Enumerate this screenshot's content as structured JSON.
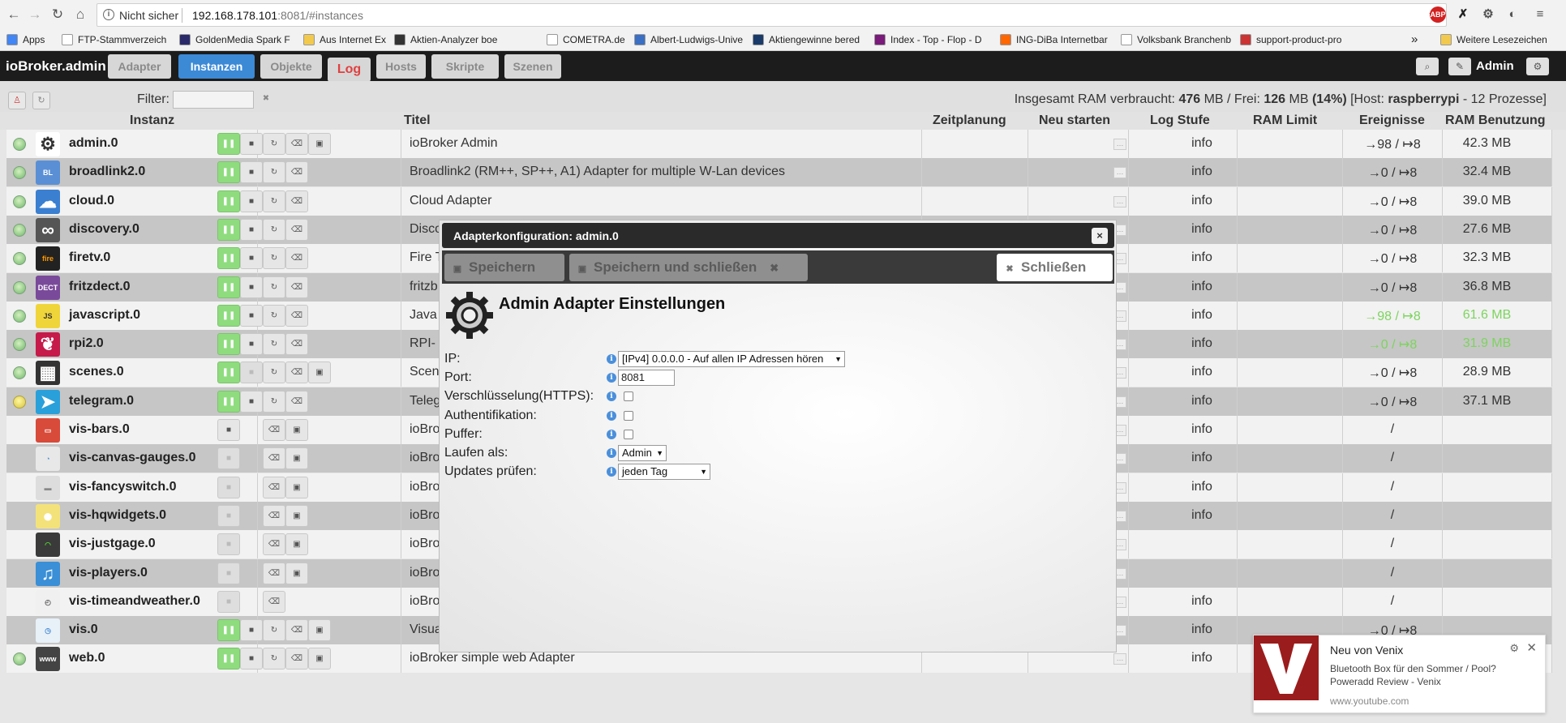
{
  "browser": {
    "security_label": "Nicht sicher",
    "url_host": "192.168.178.101",
    "url_rest": ":8081/#instances",
    "bookmarks": [
      {
        "label": "Apps",
        "color": "#4285f4"
      },
      {
        "label": "FTP-Stammverzeichn",
        "color": "#ffffff"
      },
      {
        "label": "GoldenMedia Spark F",
        "color": "#2a2a6a"
      },
      {
        "label": "Aus Internet Explorer",
        "color": "#f2c94c"
      },
      {
        "label": "Aktien-Analyzer boe",
        "color": "#333333"
      },
      {
        "label": "COMETRA.de",
        "color": "#ffffff"
      },
      {
        "label": "Albert-Ludwigs-Unive",
        "color": "#3a6fc4"
      },
      {
        "label": "Aktiengewinne bered",
        "color": "#1a3a6a"
      },
      {
        "label": "Index - Top - Flop - D",
        "color": "#7a1a7a"
      },
      {
        "label": "ING-DiBa Internetbar",
        "color": "#ff6600"
      },
      {
        "label": "Volksbank Branchenb",
        "color": "#ffffff"
      },
      {
        "label": "support-product-pro",
        "color": "#cc3333"
      },
      {
        "label": "Weitere Lesezeichen",
        "color": "#f2c94c"
      }
    ],
    "more_bookmarks": "»"
  },
  "topbar": {
    "brand": "ioBroker.admin",
    "tabs": [
      {
        "label": "Adapter",
        "active": false
      },
      {
        "label": "Instanzen",
        "active": true
      },
      {
        "label": "Objekte",
        "active": false
      },
      {
        "label": "Log",
        "active": false
      },
      {
        "label": "Hosts",
        "active": false
      },
      {
        "label": "Skripte",
        "active": false
      },
      {
        "label": "Szenen",
        "active": false
      }
    ],
    "user": "Admin"
  },
  "filter": {
    "label": "Filter:",
    "value": "",
    "ram_prefix": "Insgesamt RAM verbraucht: ",
    "ram_used": "476",
    "ram_mid": " MB / Frei: ",
    "ram_free": "126",
    "ram_mb": " MB ",
    "ram_pct": "(14%)",
    "ram_host_prefix": " [Host: ",
    "ram_host": "raspberrypi",
    "ram_suffix": " - 12 Prozesse]"
  },
  "columns": {
    "instance": "Instanz",
    "title": "Titel",
    "schedule": "Zeitplanung",
    "restart": "Neu starten",
    "loglevel": "Log Stufe",
    "ramlimit": "RAM Limit",
    "events": "Ereignisse",
    "ramusage": "RAM Benutzung"
  },
  "instances": [
    {
      "name": "admin.0",
      "title": "ioBroker Admin",
      "led": "green",
      "icon": "gear",
      "iconColor": "#ffffff",
      "controls": "full",
      "log": "info",
      "events": "→98 / ↦8",
      "ram": "42.3 MB",
      "highlight": false
    },
    {
      "name": "broadlink2.0",
      "title": "Broadlink2 (RM++, SP++, A1) Adapter for multiple W-Lan devices",
      "led": "green",
      "icon": "broadlink",
      "iconColor": "#5a8fd6",
      "controls": "noconfig",
      "log": "info",
      "events": "→0 / ↦8",
      "ram": "32.4 MB",
      "highlight": false
    },
    {
      "name": "cloud.0",
      "title": "Cloud Adapter",
      "led": "green",
      "icon": "cloud",
      "iconColor": "#3a7fd0",
      "controls": "noconfig",
      "log": "info",
      "events": "→0 / ↦8",
      "ram": "39.0 MB",
      "highlight": false
    },
    {
      "name": "discovery.0",
      "title": "Disco",
      "led": "green",
      "icon": "binoculars",
      "iconColor": "#555555",
      "controls": "noconfig",
      "log": "info",
      "events": "→0 / ↦8",
      "ram": "27.6 MB",
      "highlight": false
    },
    {
      "name": "firetv.0",
      "title": "Fire T",
      "led": "green",
      "icon": "firetv",
      "iconColor": "#222222",
      "controls": "noconfig",
      "log": "info",
      "events": "→0 / ↦8",
      "ram": "32.3 MB",
      "highlight": false
    },
    {
      "name": "fritzdect.0",
      "title": "fritzb",
      "led": "green",
      "icon": "fritz",
      "iconColor": "#7a4a9a",
      "controls": "noconfig",
      "log": "info",
      "events": "→0 / ↦8",
      "ram": "36.8 MB",
      "highlight": false
    },
    {
      "name": "javascript.0",
      "title": "Java",
      "led": "green",
      "icon": "js",
      "iconColor": "#f0d53a",
      "controls": "noconfig",
      "log": "info",
      "events": "→98 / ↦8",
      "ram": "61.6 MB",
      "highlight": true
    },
    {
      "name": "rpi2.0",
      "title": "RPI-",
      "led": "green",
      "icon": "raspberry",
      "iconColor": "#c51a4a",
      "controls": "noconfig",
      "log": "info",
      "events": "→0 / ↦8",
      "ram": "31.9 MB",
      "highlight": true
    },
    {
      "name": "scenes.0",
      "title": "Scen",
      "led": "green",
      "icon": "clapper",
      "iconColor": "#333333",
      "controls": "full-dimstop",
      "log": "info",
      "events": "→0 / ↦8",
      "ram": "28.9 MB",
      "highlight": false
    },
    {
      "name": "telegram.0",
      "title": "Teleg",
      "led": "yellow",
      "icon": "telegram",
      "iconColor": "#2aa0da",
      "controls": "noconfig",
      "log": "info",
      "events": "→0 / ↦8",
      "ram": "37.1 MB",
      "highlight": false
    },
    {
      "name": "vis-bars.0",
      "title": "ioBro",
      "led": "none",
      "icon": "visbars",
      "iconColor": "#d84a3a",
      "controls": "vis",
      "log": "info",
      "events": "/",
      "ram": "",
      "highlight": false
    },
    {
      "name": "vis-canvas-gauges.0",
      "title": "ioBro",
      "led": "none",
      "icon": "gauge",
      "iconColor": "#e8e8e8",
      "controls": "visdim",
      "log": "info",
      "events": "/",
      "ram": "",
      "highlight": false
    },
    {
      "name": "vis-fancyswitch.0",
      "title": "ioBro",
      "led": "none",
      "icon": "switch",
      "iconColor": "#dddddd",
      "controls": "visdim",
      "log": "info",
      "events": "/",
      "ram": "",
      "highlight": false
    },
    {
      "name": "vis-hqwidgets.0",
      "title": "ioBro",
      "led": "none",
      "icon": "bulb",
      "iconColor": "#f3e27a",
      "controls": "visdim",
      "log": "info",
      "events": "/",
      "ram": "",
      "highlight": false
    },
    {
      "name": "vis-justgage.0",
      "title": "ioBro",
      "led": "none",
      "icon": "justgage",
      "iconColor": "#3a3a3a",
      "controls": "visdim",
      "log": "",
      "events": "/",
      "ram": "",
      "highlight": false
    },
    {
      "name": "vis-players.0",
      "title": "ioBro",
      "led": "none",
      "icon": "music",
      "iconColor": "#3a8fd6",
      "controls": "visdim",
      "log": "",
      "events": "/",
      "ram": "",
      "highlight": false
    },
    {
      "name": "vis-timeandweather.0",
      "title": "ioBro",
      "led": "none",
      "icon": "clock",
      "iconColor": "#f0f0f0",
      "controls": "visdimnoimg",
      "log": "info",
      "events": "/",
      "ram": "",
      "highlight": false
    },
    {
      "name": "vis.0",
      "title": "Visua",
      "led": "none",
      "icon": "visgauge",
      "iconColor": "#e8f0f8",
      "controls": "full",
      "log": "info",
      "events": "→0 / ↦8",
      "ram": "",
      "highlight": false
    },
    {
      "name": "web.0",
      "title": "ioBroker simple web Adapter",
      "led": "green",
      "icon": "www",
      "iconColor": "#444444",
      "controls": "full",
      "log": "info",
      "events": "",
      "ram": "",
      "highlight": false
    }
  ],
  "dialog": {
    "title": "Adapterkonfiguration: admin.0",
    "save": "Speichern",
    "save_close": "Speichern und schließen",
    "close": "Schließen",
    "heading": "Admin Adapter Einstellungen",
    "fields": [
      {
        "label": "IP:",
        "type": "select",
        "value": "[IPv4] 0.0.0.0 - Auf allen IP Adressen hören"
      },
      {
        "label": "Port:",
        "type": "input",
        "value": "8081"
      },
      {
        "label": "Verschlüsselung(HTTPS):",
        "type": "checkbox",
        "value": ""
      },
      {
        "label": "Authentifikation:",
        "type": "checkbox",
        "value": ""
      },
      {
        "label": "Puffer:",
        "type": "checkbox",
        "value": ""
      },
      {
        "label": "Laufen als:",
        "type": "select",
        "value": "Admin"
      },
      {
        "label": "Updates prüfen:",
        "type": "select",
        "value": "jeden Tag"
      }
    ]
  },
  "toast": {
    "title": "Neu von Venix",
    "body": "Bluetooth Box für den Sommer / Pool? Poweradd Review - Venix",
    "source": "www.youtube.com"
  }
}
